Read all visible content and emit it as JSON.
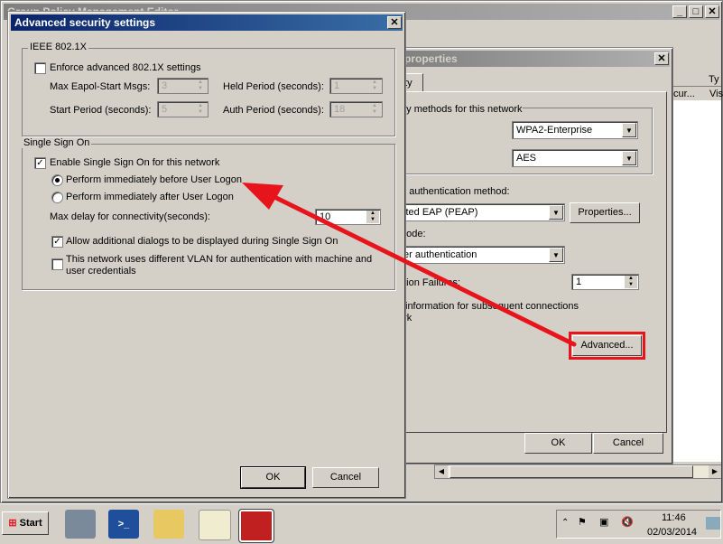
{
  "bg_window": {
    "title": "Group Policy Management Editor",
    "col_headers": [
      "Ty",
      "Vis"
    ],
    "col_sub": "cur..."
  },
  "props_dialog": {
    "title": "properties",
    "tab": "rity",
    "security_label": "rity methods for this network",
    "security_type": "WPA2-Enterprise",
    "encryption_type": "AES",
    "auth_method_label": "rk authentication method:",
    "auth_method": "cted EAP (PEAP)",
    "properties_btn": "Properties...",
    "mode_label": "Mode:",
    "mode_value": "ter authentication",
    "failures_label": "ation Failures:",
    "failures_value": "1",
    "cache_line1": "information for subsequent connections",
    "cache_line2": "ork",
    "advanced_btn": "Advanced...",
    "ok": "OK",
    "cancel": "Cancel"
  },
  "adv_dialog": {
    "title": "Advanced security settings",
    "ieee_group": "IEEE 802.1X",
    "enforce_label": "Enforce advanced 802.1X settings",
    "max_eapol_label": "Max Eapol-Start Msgs:",
    "max_eapol_value": "3",
    "held_label": "Held Period (seconds):",
    "held_value": "1",
    "start_label": "Start Period (seconds):",
    "start_value": "5",
    "auth_label": "Auth Period (seconds):",
    "auth_value": "18",
    "sso_group": "Single Sign On",
    "enable_sso_label": "Enable Single Sign On for this network",
    "before_logon_label": "Perform immediately before User Logon",
    "after_logon_label": "Perform immediately after User Logon",
    "max_delay_label": "Max delay for connectivity(seconds):",
    "max_delay_value": "10",
    "allow_dialogs_label": "Allow additional dialogs to be displayed during Single Sign On",
    "vlan_label_1": "This network uses different VLAN for authentication with machine and",
    "vlan_label_2": "user credentials",
    "ok": "OK",
    "cancel": "Cancel"
  },
  "taskbar": {
    "start": "Start",
    "time": "11:46",
    "date": "02/03/2014"
  },
  "colors": {
    "annotation_red": "#e8141c",
    "title_active": "#0a246a"
  }
}
